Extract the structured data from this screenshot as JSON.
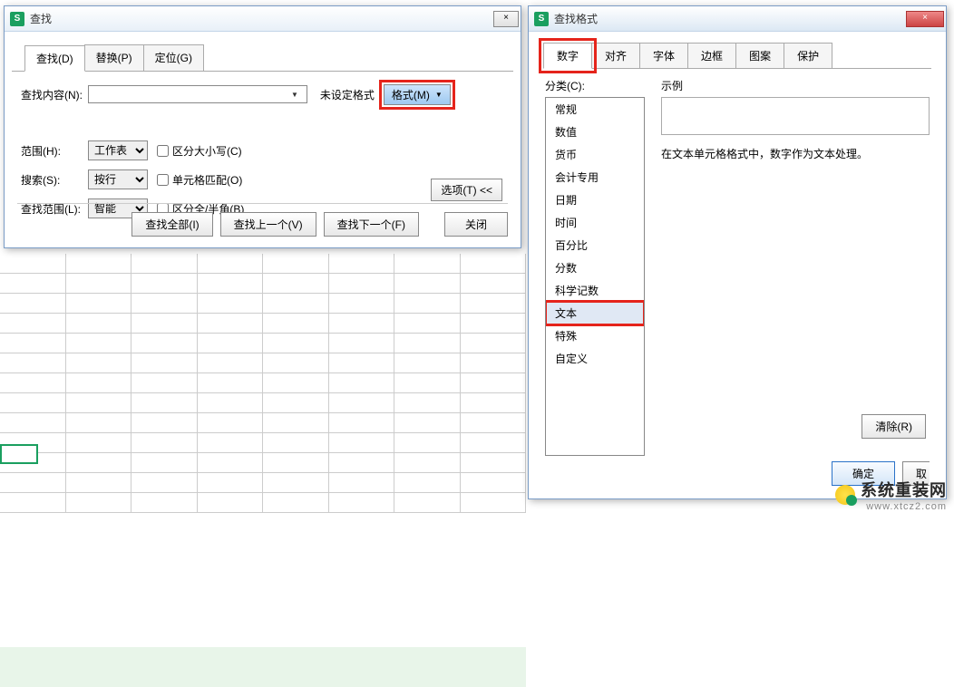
{
  "find_dialog": {
    "title": "查找",
    "tabs": {
      "find": "查找(D)",
      "replace": "替换(P)",
      "goto": "定位(G)"
    },
    "labels": {
      "content": "查找内容(N):",
      "scope": "范围(H):",
      "search": "搜索(S):",
      "look_in": "查找范围(L):"
    },
    "format_status": "未设定格式",
    "format_button": "格式(M)",
    "dropdowns": {
      "scope": "工作表",
      "search": "按行",
      "look_in": "智能"
    },
    "checkboxes": {
      "match_case": "区分大小写(C)",
      "match_cell": "单元格匹配(O)",
      "match_width": "区分全/半角(B)"
    },
    "options_btn": "选项(T) <<",
    "buttons": {
      "find_all": "查找全部(I)",
      "find_prev": "查找上一个(V)",
      "find_next": "查找下一个(F)",
      "close": "关闭"
    }
  },
  "format_dialog": {
    "title": "查找格式",
    "tabs": {
      "number": "数字",
      "align": "对齐",
      "font": "字体",
      "border": "边框",
      "pattern": "图案",
      "protect": "保护"
    },
    "category_label": "分类(C):",
    "categories": {
      "general": "常规",
      "number": "数值",
      "currency": "货币",
      "accounting": "会计专用",
      "date": "日期",
      "time": "时间",
      "percentage": "百分比",
      "fraction": "分数",
      "scientific": "科学记数",
      "text": "文本",
      "special": "特殊",
      "custom": "自定义"
    },
    "sample_label": "示例",
    "sample_desc": "在文本单元格格式中，数字作为文本处理。",
    "clear_btn": "清除(R)",
    "ok_btn": "确定",
    "cancel_btn": "取"
  },
  "watermark": {
    "cn": "系统重装网",
    "url": "www.xtcz2.com"
  },
  "icons": {
    "app": "S",
    "close": "×",
    "dropdown": "▼"
  }
}
